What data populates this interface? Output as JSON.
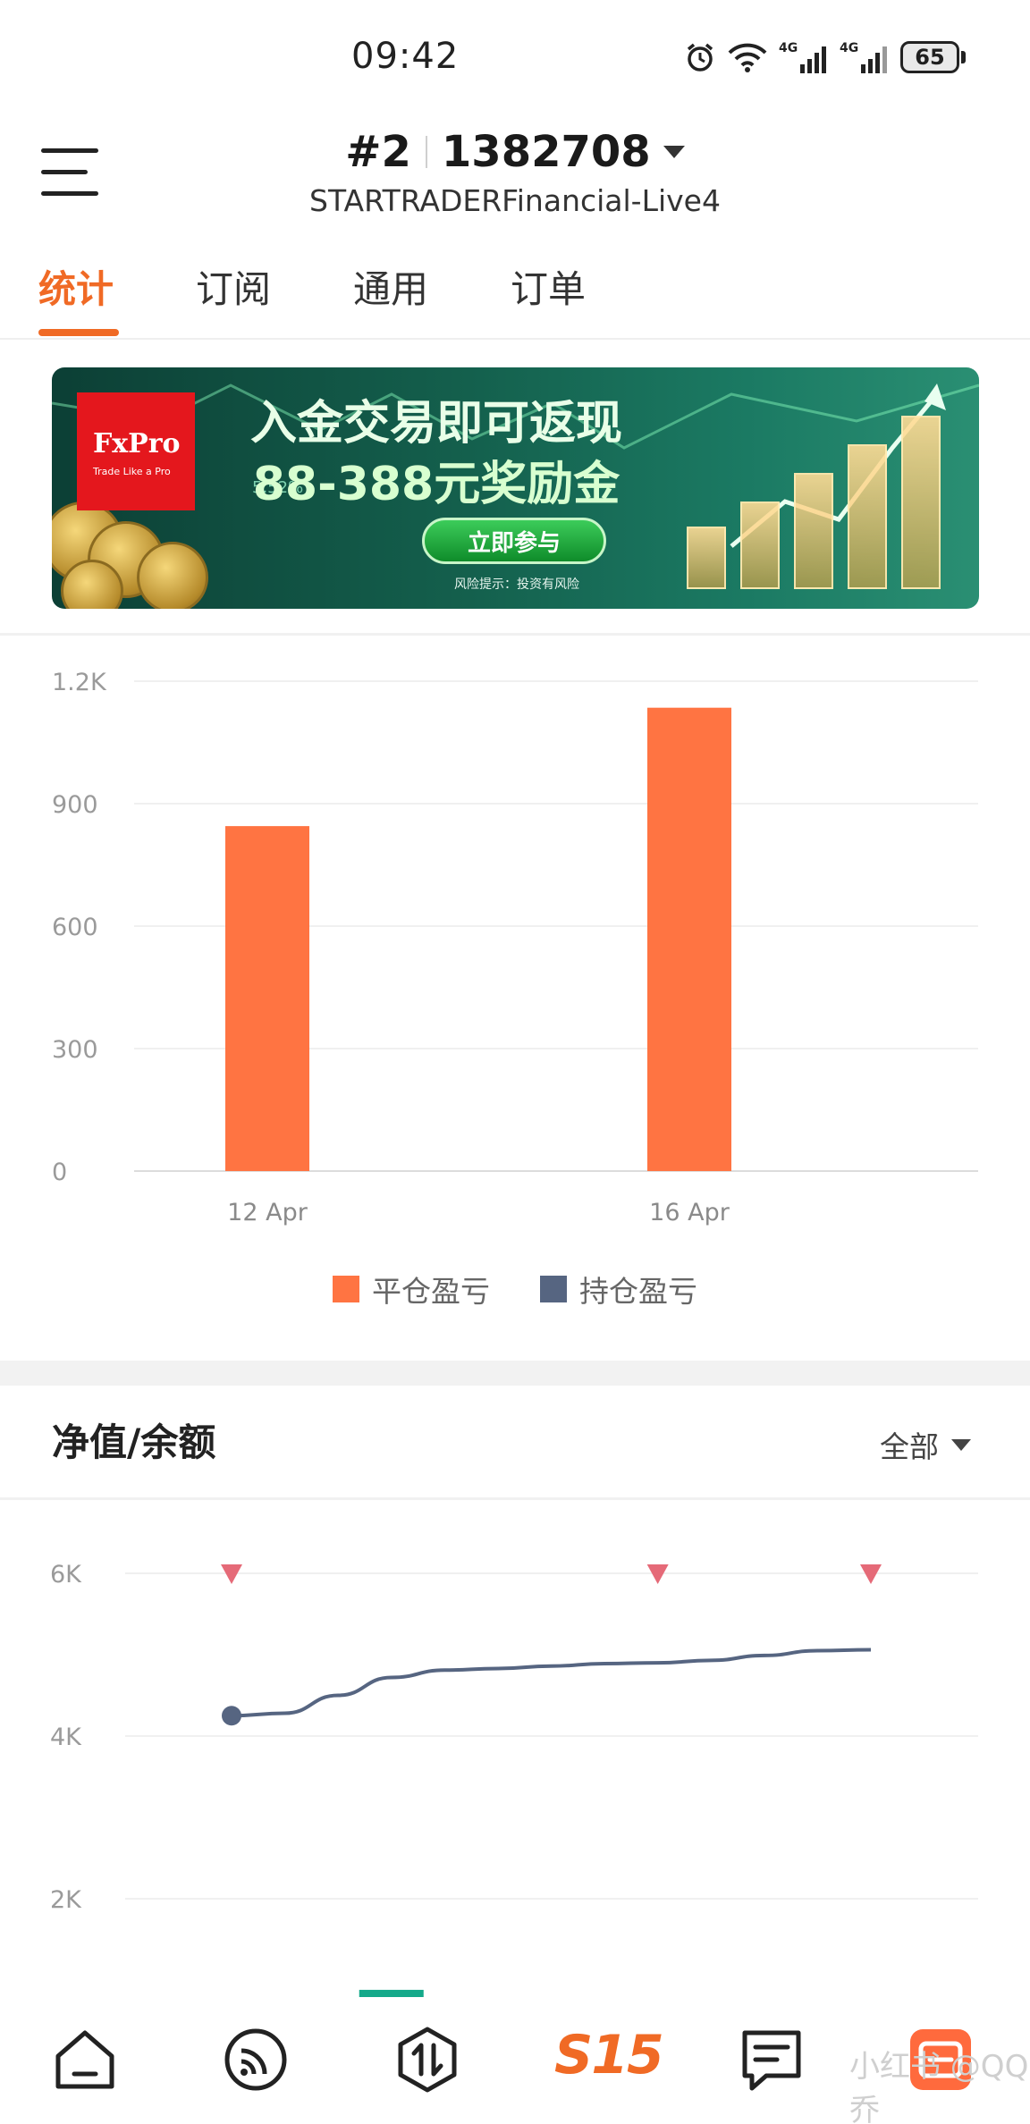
{
  "status_bar": {
    "time": "09:42",
    "battery": "65",
    "network_1": "4G",
    "network_2": "4G"
  },
  "header": {
    "menu_icon": "hamburger-menu-icon",
    "account_index": "#2",
    "account_number": "1382708",
    "server": "STARTRADERFinancial-Live4"
  },
  "tabs": [
    {
      "label": "统计",
      "active": true
    },
    {
      "label": "订阅",
      "active": false
    },
    {
      "label": "通用",
      "active": false
    },
    {
      "label": "订单",
      "active": false
    }
  ],
  "banner": {
    "brand": "FxPro",
    "tagline": "Trade Like a Pro",
    "headline": "入金交易即可返现",
    "subheadline": "88-388元奖励金",
    "cta": "立即参与",
    "risk_note": "风险提示：投资有风险",
    "percent": "5.52%"
  },
  "chart_data": [
    {
      "type": "bar",
      "categories": [
        "12 Apr",
        "16 Apr"
      ],
      "series": [
        {
          "name": "平仓盈亏",
          "values": [
            845,
            1135
          ],
          "color": "#ff7442"
        },
        {
          "name": "持仓盈亏",
          "values": [
            0,
            0
          ],
          "color": "#566581"
        }
      ],
      "yticks": [
        "1.2K",
        "900",
        "600",
        "300",
        "0"
      ],
      "ylim": [
        0,
        1200
      ],
      "grid": true,
      "legend": "bottom-center"
    },
    {
      "type": "line",
      "title": "净值/余额",
      "range_label": "全部",
      "yticks": [
        "6K",
        "4K",
        "2K"
      ],
      "ylim": [
        0,
        6000
      ],
      "x": [
        0,
        1,
        2,
        3,
        4,
        5,
        6,
        7,
        8,
        9,
        10,
        11,
        12
      ],
      "series": [
        {
          "name": "equity",
          "values": [
            4250,
            4280,
            4500,
            4720,
            4810,
            4830,
            4860,
            4890,
            4900,
            4930,
            4990,
            5050,
            5060
          ],
          "color": "#566581"
        }
      ],
      "markers": [
        0,
        8,
        12
      ],
      "marker_color": "#e56a78",
      "deposit_bars": [
        {
          "x": 3,
          "value": 880,
          "color": "#14a98a"
        }
      ],
      "grid": true
    }
  ],
  "bottom_nav": {
    "items": [
      "home-icon",
      "signals-icon",
      "trade-icon",
      "s15-icon",
      "messages-icon",
      "profile-icon"
    ],
    "s15_label": "S15"
  },
  "watermark": "小红书 @QQ乔"
}
